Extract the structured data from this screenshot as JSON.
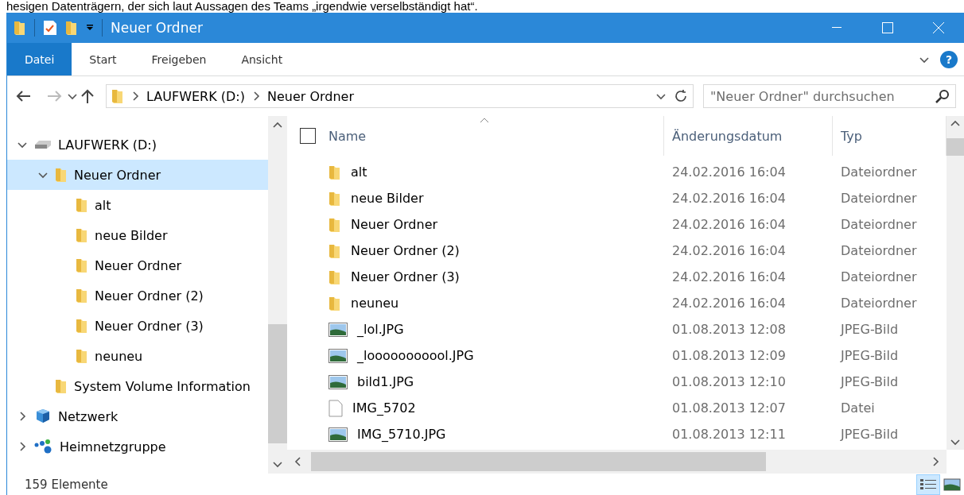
{
  "page_text": "hesigen Datenträgern, der sich laut Aussagen des Teams „irgendwie verselbständigt hat“.",
  "window": {
    "title": "Neuer Ordner"
  },
  "ribbon_tabs": [
    {
      "label": "Datei",
      "kind": "file"
    },
    {
      "label": "Start",
      "kind": "tab"
    },
    {
      "label": "Freigeben",
      "kind": "tab"
    },
    {
      "label": "Ansicht",
      "kind": "tab"
    }
  ],
  "help": "?",
  "address": {
    "crumbs": [
      "LAUFWERK (D:)",
      "Neuer Ordner"
    ]
  },
  "search": {
    "placeholder": "\"Neuer Ordner\" durchsuchen"
  },
  "nav": [
    {
      "label": "LAUFWERK (D:)",
      "kind": "drive",
      "expanded": true,
      "selected": false,
      "children": [
        {
          "label": "Neuer Ordner",
          "kind": "folder",
          "expanded": true,
          "selected": true,
          "children": [
            {
              "label": "alt",
              "kind": "folder",
              "selected": false
            },
            {
              "label": "neue Bilder",
              "kind": "folder",
              "selected": false
            },
            {
              "label": "Neuer Ordner",
              "kind": "folder",
              "selected": false
            },
            {
              "label": "Neuer Ordner (2)",
              "kind": "folder",
              "selected": false
            },
            {
              "label": "Neuer Ordner (3)",
              "kind": "folder",
              "selected": false
            },
            {
              "label": "neuneu",
              "kind": "folder",
              "selected": false
            }
          ]
        },
        {
          "label": "System Volume Information",
          "kind": "folder",
          "selected": false
        }
      ]
    },
    {
      "label": "Netzwerk",
      "kind": "network",
      "expanded": false,
      "selected": false
    },
    {
      "label": "Heimnetzgruppe",
      "kind": "homegroup",
      "expanded": false,
      "selected": false
    }
  ],
  "table": {
    "select_all": {
      "checked": false
    },
    "columns": [
      "Name",
      "Änderungsdatum",
      "Typ"
    ],
    "rows": [
      {
        "name": "alt",
        "date": "24.02.2016 16:04",
        "type": "Dateiordner",
        "kind": "folder"
      },
      {
        "name": "neue Bilder",
        "date": "24.02.2016 16:04",
        "type": "Dateiordner",
        "kind": "folder"
      },
      {
        "name": "Neuer Ordner",
        "date": "24.02.2016 16:04",
        "type": "Dateiordner",
        "kind": "folder"
      },
      {
        "name": "Neuer Ordner (2)",
        "date": "24.02.2016 16:04",
        "type": "Dateiordner",
        "kind": "folder"
      },
      {
        "name": "Neuer Ordner (3)",
        "date": "24.02.2016 16:04",
        "type": "Dateiordner",
        "kind": "folder"
      },
      {
        "name": "neuneu",
        "date": "24.02.2016 16:04",
        "type": "Dateiordner",
        "kind": "folder"
      },
      {
        "name": "_lol.JPG",
        "date": "01.08.2013 12:08",
        "type": "JPEG-Bild",
        "kind": "image"
      },
      {
        "name": "_looooooooool.JPG",
        "date": "01.08.2013 12:09",
        "type": "JPEG-Bild",
        "kind": "image"
      },
      {
        "name": "bild1.JPG",
        "date": "01.08.2013 12:10",
        "type": "JPEG-Bild",
        "kind": "image"
      },
      {
        "name": "IMG_5702",
        "date": "01.08.2013 12:07",
        "type": "Datei",
        "kind": "file"
      },
      {
        "name": "IMG_5710.JPG",
        "date": "01.08.2013 12:11",
        "type": "JPEG-Bild",
        "kind": "image"
      }
    ]
  },
  "status_bar": {
    "count": "159 Elemente",
    "views": [
      {
        "kind": "details",
        "selected": true
      },
      {
        "kind": "large",
        "selected": false
      }
    ]
  }
}
